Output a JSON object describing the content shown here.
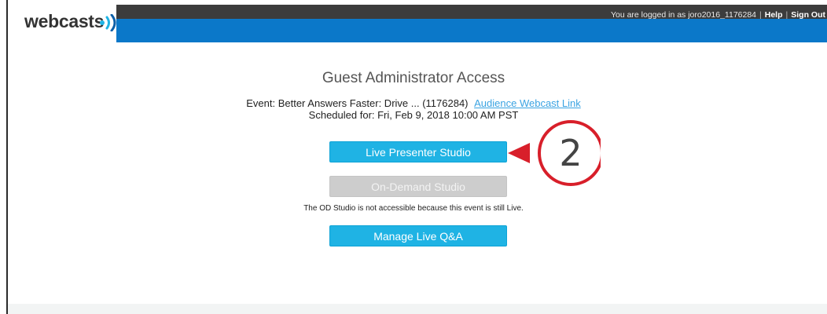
{
  "header": {
    "logo_text": "webcasts",
    "user_text": "You are logged in as joro2016_1176284",
    "help_label": "Help",
    "signout_label": "Sign Out"
  },
  "main": {
    "title": "Guest Administrator Access",
    "event_text": "Event: Better Answers Faster: Drive ... (1176284)",
    "audience_link": "Audience Webcast Link",
    "scheduled_text": "Scheduled for: Fri, Feb 9, 2018 10:00 AM PST",
    "live_button": "Live Presenter Studio",
    "od_button": "On-Demand Studio",
    "od_note": "The OD Studio is not accessible because this event is still Live.",
    "qa_button": "Manage Live Q&A"
  },
  "callout": {
    "number": "2",
    "color": "#d81f2a"
  },
  "colors": {
    "blue_bar": "#0b78c9",
    "button_blue": "#1fb3e4",
    "button_disabled": "#cdcdcd"
  }
}
